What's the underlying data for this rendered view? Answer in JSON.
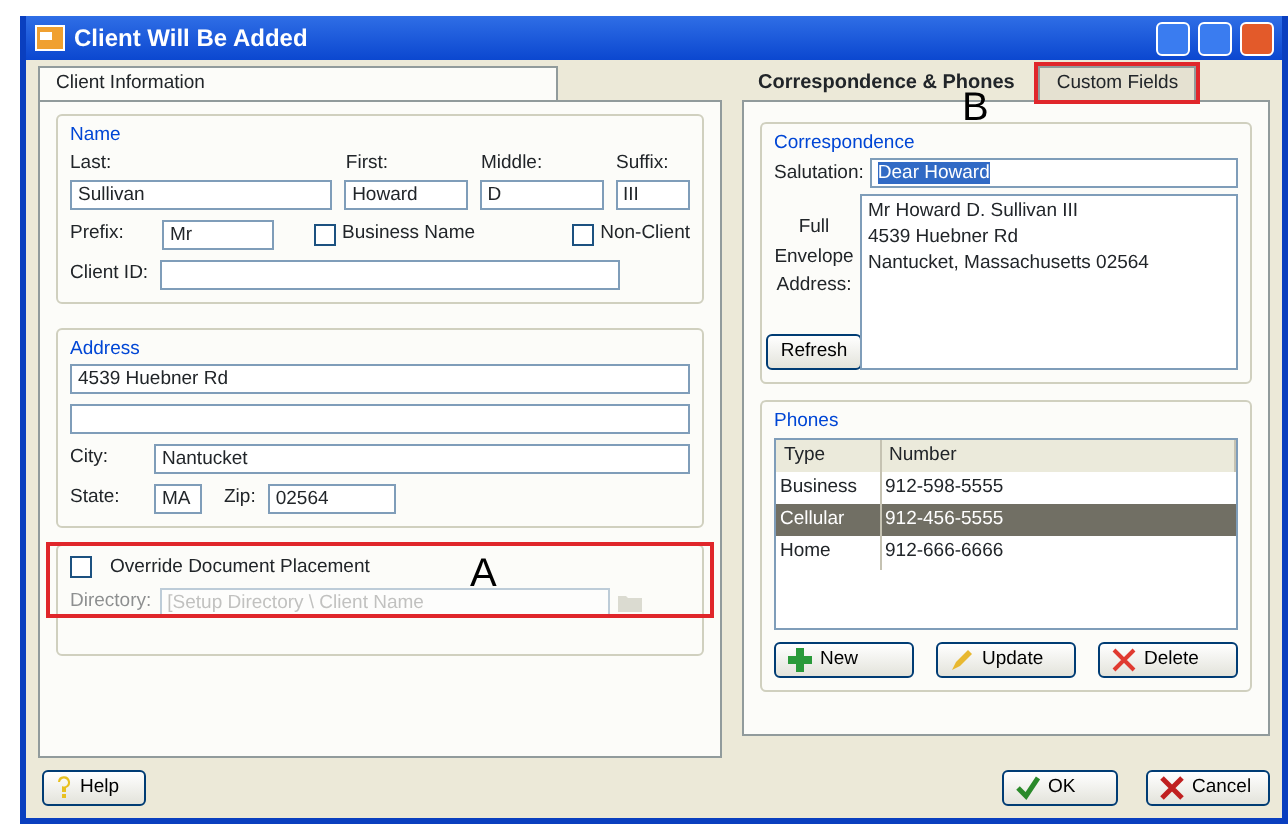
{
  "window": {
    "title": "Client Will Be Added"
  },
  "left_tab": {
    "label": "Client Information",
    "selected": true
  },
  "name_group": {
    "legend": "Name",
    "last_label": "Last:",
    "last": "Sullivan",
    "first_label": "First:",
    "first": "Howard",
    "middle_label": "Middle:",
    "middle": "D",
    "suffix_label": "Suffix:",
    "suffix": "III",
    "prefix_label": "Prefix:",
    "prefix": "Mr",
    "business_name": {
      "label": "Business Name",
      "checked": false
    },
    "non_client": {
      "label": "Non-Client",
      "checked": false
    },
    "client_id_label": "Client ID:"
  },
  "address_group": {
    "legend": "Address",
    "line1": "4539 Huebner Rd",
    "city_label": "City:",
    "city": "Nantucket",
    "state_label": "State:",
    "state": "MA",
    "zip_label": "Zip:",
    "zip": "02564"
  },
  "override": {
    "label": "Override Document Placement",
    "checked": false,
    "directory_label": "Directory:",
    "directory": "[Setup Directory \\ Client Name"
  },
  "right_tabs": [
    {
      "label": "Correspondence & Phones",
      "selected": true
    },
    {
      "label": "Custom Fields",
      "selected": false
    }
  ],
  "correspondence": {
    "legend": "Correspondence",
    "salutation_label": "Salutation:",
    "salutation": "Dear Howard",
    "envelope_label": "Full Envelope Address:",
    "envelope_lines": [
      "Mr Howard D. Sullivan III",
      "4539 Huebner Rd",
      "Nantucket, Massachusetts  02564"
    ],
    "refresh": "Refresh"
  },
  "phones": {
    "legend": "Phones",
    "columns": [
      "Type",
      "Number"
    ],
    "rows": [
      {
        "type": "Business",
        "number": "912-598-5555",
        "selected": false
      },
      {
        "type": "Cellular",
        "number": "912-456-5555",
        "selected": true
      },
      {
        "type": "Home",
        "number": "912-666-6666",
        "selected": false
      }
    ],
    "buttons": [
      {
        "kind": "new",
        "label": "New"
      },
      {
        "kind": "update",
        "label": "Update"
      },
      {
        "kind": "delete",
        "label": "Delete"
      }
    ]
  },
  "annotations": [
    {
      "label": "A"
    },
    {
      "label": "B"
    }
  ],
  "footer": {
    "help": "Help",
    "ok": "OK",
    "cancel": "Cancel"
  }
}
